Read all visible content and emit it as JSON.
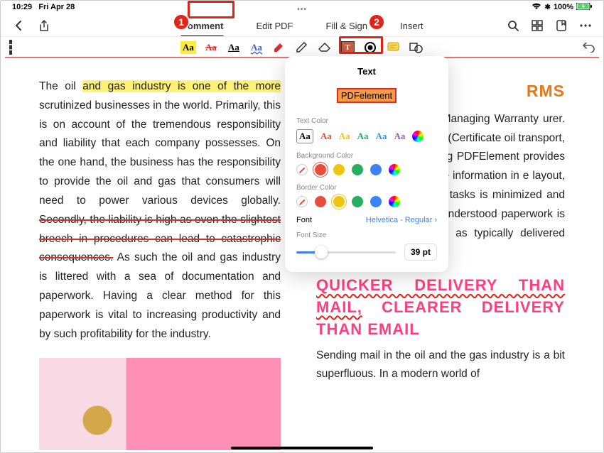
{
  "status": {
    "time": "10:29",
    "date": "Fri Apr 28",
    "bluetooth": "100%"
  },
  "toolbar": {
    "tabs": [
      "Comment",
      "Edit PDF",
      "Fill & Sign",
      "Insert"
    ],
    "active": "Comment"
  },
  "callouts": {
    "one": "1",
    "two": "2"
  },
  "text_panel": {
    "title": "Text",
    "sample": "PDFelement",
    "labels": {
      "text_color": "Text Color",
      "bg_color": "Background Color",
      "border_color": "Border Color",
      "font": "Font",
      "font_size": "Font Size"
    },
    "font_value": "Helvetica - Regular",
    "size_value": "39 pt",
    "aa": "Aa"
  },
  "doc": {
    "left_p1_a": "The oil ",
    "left_p1_hl": "and gas industry is one of the more",
    "left_p1_b": " scrutinized businesses in the world. Primarily, this is on account of the tremendous responsibility and liability that each company possesses. On the one hand, the business has the responsibility to provide the oil and gas that consumers will need to power various devices globally. ",
    "left_p1_strike": "Secondly, the liability is high as even the slightest breech in procedures can lead to catastrophic consequences.",
    "left_p1_c": " As such the oil and gas industry is littered with a sea of documentation and paperwork. Having a clear method for this paperwork is vital to increasing productivity and by such profitability for the industry.",
    "right_h1": "RMS",
    "right_p1": "y a back and forth of S (Managing Warranty urer. Since the MWS ive a COA (Certificate oil transport, a clear ology for presenting PDFElement provides o present information g the information in e layout, productivity need to re-do tasks is minimized and (b) lost paperwork or misunderstood paperwork is greatly reduced as PDFs as typically delivered digitally.",
    "right_h2_wavy": "QUICKER DELIVERY THAN MAIL,",
    "right_h2_rest": " CLEARER DELIVERY THAN EMAIL",
    "right_p2": "Sending mail in the oil and the gas industry is a bit superfluous. In a modern world of"
  }
}
